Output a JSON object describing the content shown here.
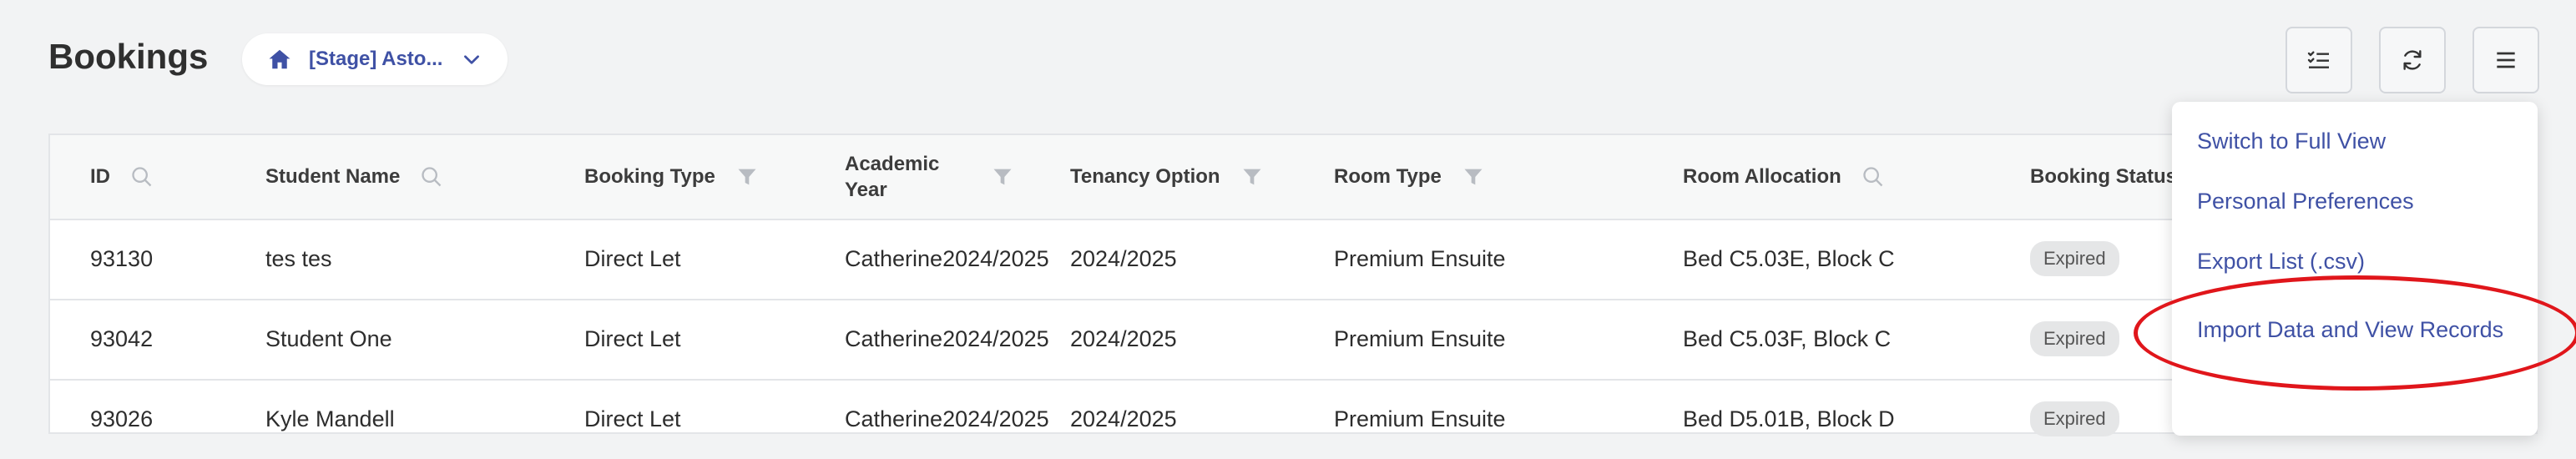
{
  "page": {
    "title": "Bookings"
  },
  "site_selector": {
    "value": "[Stage] Asto..."
  },
  "table": {
    "columns": [
      {
        "label": "ID",
        "icon": "search-icon"
      },
      {
        "label": "Student Name",
        "icon": "search-icon"
      },
      {
        "label": "Booking Type",
        "icon": "filter-icon"
      },
      {
        "label_line1": "Academic",
        "label_line2": "Year",
        "icon": "filter-icon"
      },
      {
        "label": "Tenancy Option",
        "icon": "filter-icon"
      },
      {
        "label": "Room Type",
        "icon": "filter-icon"
      },
      {
        "label": "Room Allocation",
        "icon": "search-icon"
      },
      {
        "label": "Booking Status"
      }
    ],
    "rows": [
      {
        "id": "93130",
        "student": "tes tes",
        "booking_type": "Direct Let",
        "academic_year": "Catherine2024/2025",
        "tenancy": "2024/2025",
        "room_type": "Premium Ensuite",
        "room_allocation": "Bed C5.03E, Block C",
        "status": "Expired"
      },
      {
        "id": "93042",
        "student": "Student One",
        "booking_type": "Direct Let",
        "academic_year": "Catherine2024/2025",
        "tenancy": "2024/2025",
        "room_type": "Premium Ensuite",
        "room_allocation": "Bed C5.03F, Block C",
        "status": "Expired"
      },
      {
        "id": "93026",
        "student": "Kyle Mandell",
        "booking_type": "Direct Let",
        "academic_year": "Catherine2024/2025",
        "tenancy": "2024/2025",
        "room_type": "Premium Ensuite",
        "room_allocation": "Bed D5.01B, Block D",
        "status": "Expired"
      }
    ]
  },
  "menu": {
    "items": [
      "Switch to Full View",
      "Personal Preferences",
      "Export List (.csv)",
      "Import Data and View Records"
    ]
  },
  "toolbar": {
    "icons": [
      "checklist-icon",
      "refresh-icon",
      "hamburger-menu-icon"
    ]
  },
  "colors": {
    "accent": "#3f51a5",
    "highlight": "#e0161b",
    "badge": "#e5e6e7"
  }
}
